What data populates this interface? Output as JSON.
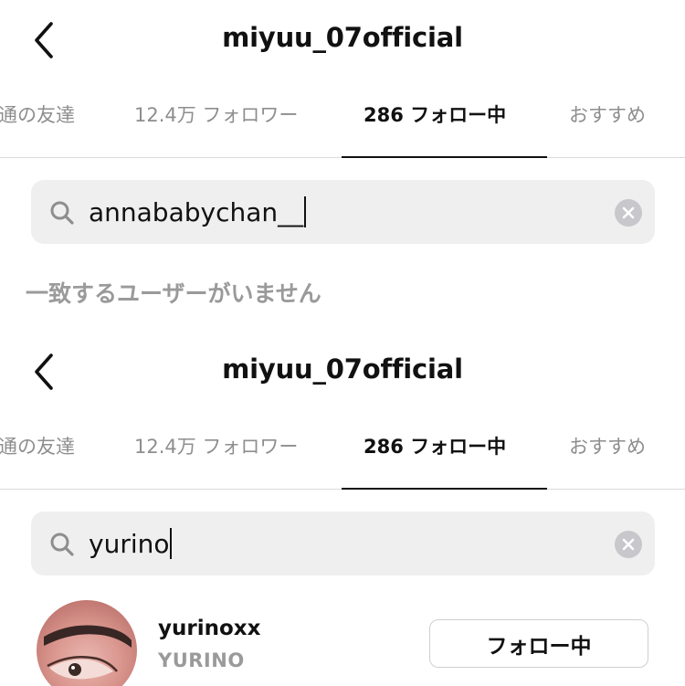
{
  "panels": [
    {
      "header": {
        "title": "miyuu_07official"
      },
      "tabs": [
        {
          "label": "通の友達",
          "active": false
        },
        {
          "label": "12.4万 フォロワー",
          "active": false
        },
        {
          "label": "286 フォロー中",
          "active": true
        },
        {
          "label": "おすすめ",
          "active": false
        }
      ],
      "search": {
        "value": "annababychan__"
      },
      "empty_message": "一致するユーザーがいません"
    },
    {
      "header": {
        "title": "miyuu_07official"
      },
      "tabs": [
        {
          "label": "通の友達",
          "active": false
        },
        {
          "label": "12.4万 フォロワー",
          "active": false
        },
        {
          "label": "286 フォロー中",
          "active": true
        },
        {
          "label": "おすすめ",
          "active": false
        }
      ],
      "search": {
        "value": "yurino"
      },
      "result": {
        "username": "yurinoxx",
        "full_name": "YURINO",
        "button_label": "フォロー中"
      }
    }
  ],
  "icons": {
    "back": "chevron-left-icon",
    "search": "search-icon",
    "clear": "clear-icon"
  },
  "colors": {
    "text_primary": "#111111",
    "text_secondary": "#8e8e8e",
    "search_background": "#efefef",
    "divider": "#dbdbdb"
  }
}
